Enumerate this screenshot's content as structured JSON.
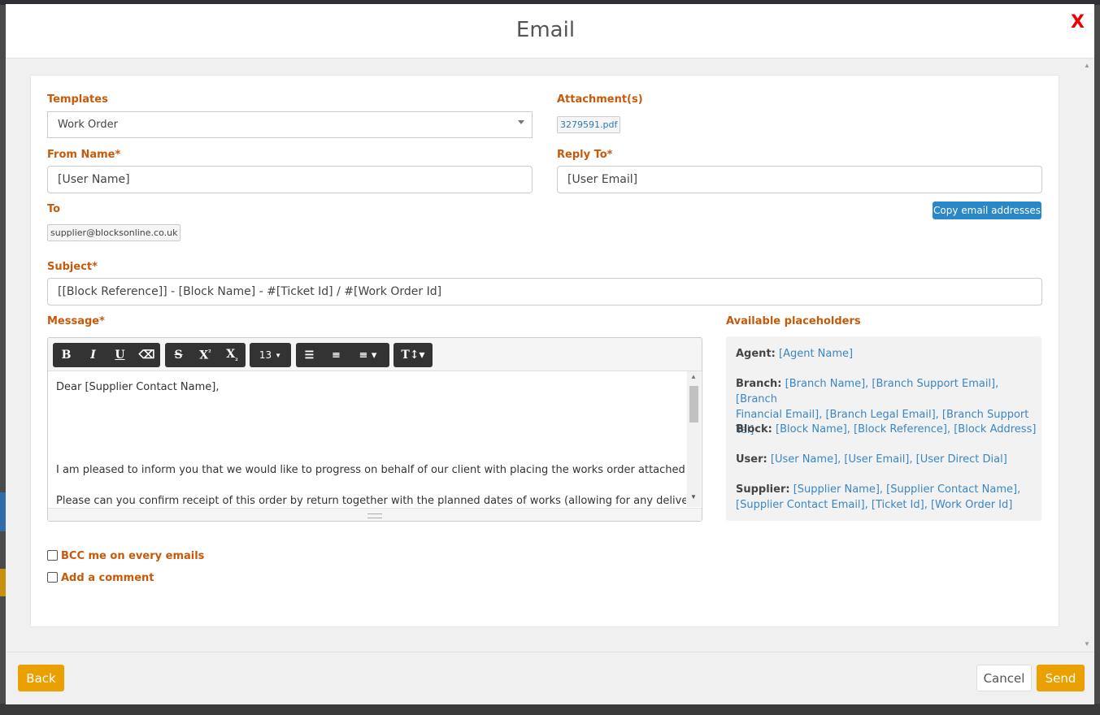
{
  "modal": {
    "title": "Email",
    "close_label": "X"
  },
  "form": {
    "templates_label": "Templates",
    "templates_value": "Work Order",
    "attachments_label": "Attachment(s)",
    "attachment_file": "3279591.pdf",
    "from_name_label": "From Name*",
    "from_name_value": "[User Name]",
    "reply_to_label": "Reply To*",
    "reply_to_value": "[User Email]",
    "to_label": "To",
    "to_tag": "supplier@blocksonline.co.uk",
    "copy_button": "Copy email addresses",
    "subject_label": "Subject*",
    "subject_value": "[[Block Reference]] - [Block Name] - #[Ticket Id] / #[Work Order Id]",
    "message_label": "Message*"
  },
  "toolbar": {
    "bold": "B",
    "italic": "I",
    "underline": "U",
    "strike": "S",
    "superscript": "X",
    "subscript": "X",
    "font_size": "13"
  },
  "message": {
    "line1": "Dear [Supplier Contact Name],",
    "line2": "I am pleased to inform you that we would like to progress on behalf of our client with placing the works order attached.",
    "line3": "Please can you confirm receipt of this order by return together with the planned dates of works (allowing for any delivery"
  },
  "placeholders": {
    "title": "Available placeholders",
    "agent_label": "Agent:",
    "agent_values": "[Agent Name]",
    "branch_label": "Branch:",
    "branch_values_1": "[Branch Name], [Branch Support Email], [Branch",
    "branch_values_2": "Financial Email], [Branch Legal Email], [Branch Support Tel]",
    "block_label": "Block:",
    "block_values": "[Block Name], [Block Reference], [Block Address]",
    "user_label": "User:",
    "user_values": "[User Name], [User Email], [User Direct Dial]",
    "supplier_label": "Supplier:",
    "supplier_values_1": "[Supplier Name], [Supplier Contact Name],",
    "supplier_values_2": "[Supplier Contact Email], [Ticket Id], [Work Order Id]"
  },
  "options": {
    "bcc_label": "BCC me on every emails",
    "comment_label": "Add a comment"
  },
  "footer": {
    "back": "Back",
    "cancel": "Cancel",
    "send": "Send"
  }
}
